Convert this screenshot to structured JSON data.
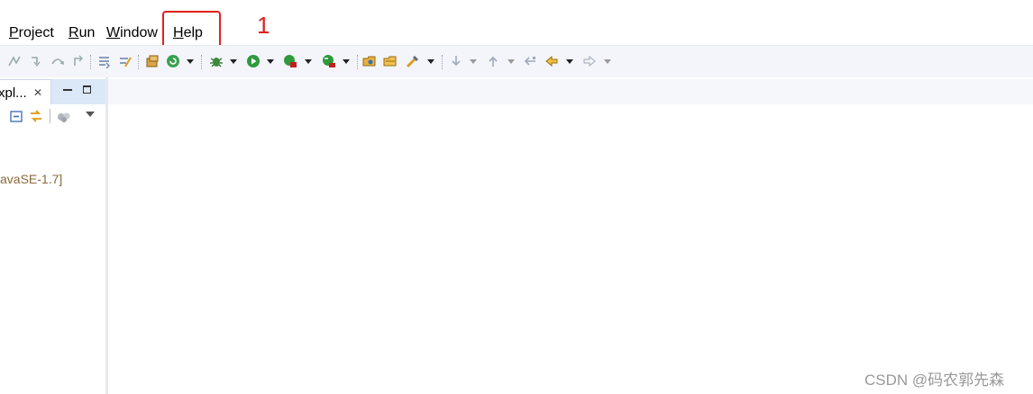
{
  "menubar": {
    "items": [
      {
        "prefix": "",
        "mnemonic": "P",
        "rest": "roject"
      },
      {
        "prefix": "",
        "mnemonic": "R",
        "rest": "un"
      },
      {
        "prefix": "",
        "mnemonic": "W",
        "rest": "indow"
      },
      {
        "prefix": "",
        "mnemonic": "H",
        "rest": "elp"
      }
    ]
  },
  "annotation": {
    "step_number": "1",
    "highlight_color": "#e02020"
  },
  "toolbar": {
    "icons": [
      "skip-all-breakpoints-icon",
      "step-into-icon",
      "step-over-icon",
      "step-return-icon",
      "use-step-filters-icon",
      "drop-to-frame-icon",
      "new-java-package-icon",
      "refresh-icon",
      "debug-icon",
      "run-icon",
      "coverage-icon",
      "run-last-tool-icon",
      "open-type-icon",
      "open-task-icon",
      "search-icon",
      "next-annotation-icon",
      "previous-annotation-icon",
      "last-edit-location-icon",
      "back-icon",
      "forward-icon"
    ]
  },
  "left_view": {
    "tab_label": "xpl...",
    "close_glyph": "✕",
    "tree_item": "avaSE-1.7]"
  },
  "watermark": "CSDN @码农郭先森"
}
